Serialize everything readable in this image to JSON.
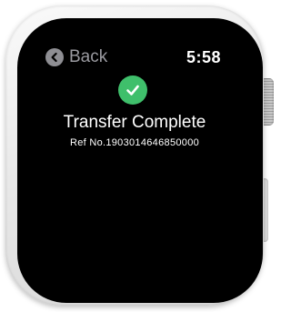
{
  "nav": {
    "back_label": "Back",
    "time": "5:58"
  },
  "confirmation": {
    "title": "Transfer Complete",
    "reference": "Ref No.1903014646850000"
  },
  "icons": {
    "back": "chevron-left-circle-icon",
    "status": "checkmark-circle-icon"
  },
  "colors": {
    "screen_background": "#000000",
    "success_green": "#3fbf6b",
    "back_gray": "#9a9aa0"
  }
}
